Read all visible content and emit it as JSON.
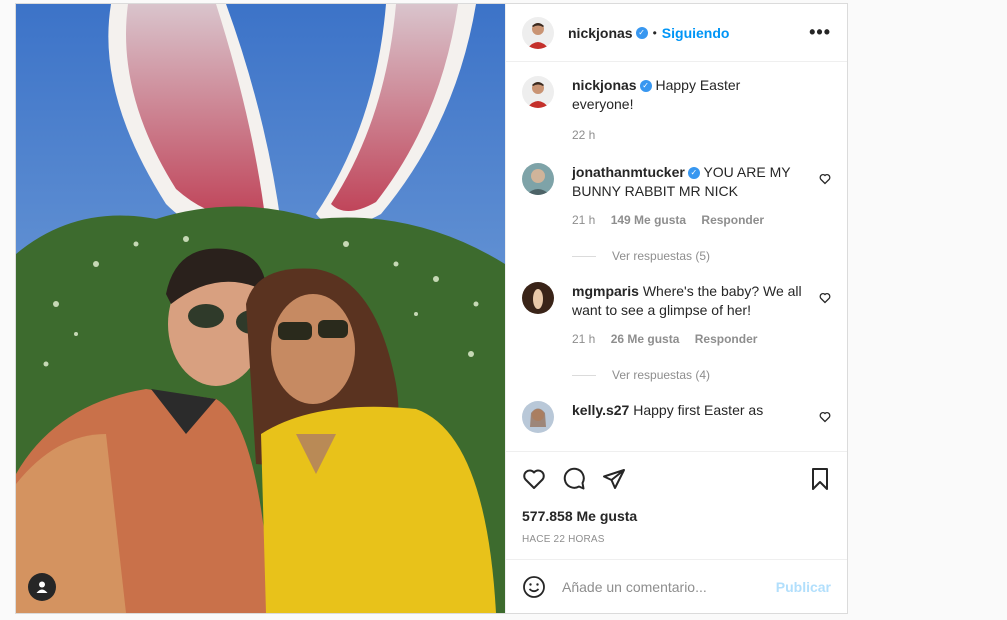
{
  "header": {
    "username": "nickjonas",
    "follow_label": "Siguiendo",
    "more_label": "•••"
  },
  "caption": {
    "username": "nickjonas",
    "text": "Happy Easter everyone!",
    "time": "22 h"
  },
  "comments": [
    {
      "username": "jonathanmtucker",
      "verified": true,
      "text": "YOU ARE MY BUNNY RABBIT MR NICK",
      "time": "21 h",
      "likes": "149 Me gusta",
      "reply_label": "Responder",
      "view_replies": "Ver respuestas (5)"
    },
    {
      "username": "mgmparis",
      "verified": false,
      "text": "Where's the baby? We all want to see a glimpse of her!",
      "time": "21 h",
      "likes": "26 Me gusta",
      "reply_label": "Responder",
      "view_replies": "Ver respuestas (4)"
    },
    {
      "username": "kelly.s27",
      "verified": false,
      "text": "Happy first Easter as"
    }
  ],
  "post": {
    "likes": "577.858 Me gusta",
    "time_ago": "HACE 22 HORAS"
  },
  "add_comment": {
    "placeholder": "Añade un comentario...",
    "publish_label": "Publicar"
  },
  "icons": {
    "like": "heart-icon",
    "comment": "comment-icon",
    "share": "send-icon",
    "save": "bookmark-icon",
    "emoji": "emoji-icon",
    "tag": "user-tag-icon"
  },
  "colors": {
    "accent": "#0095f6",
    "verified": "#3897f0",
    "publish_disabled": "#b2dffc",
    "muted": "#8e8e8e"
  }
}
